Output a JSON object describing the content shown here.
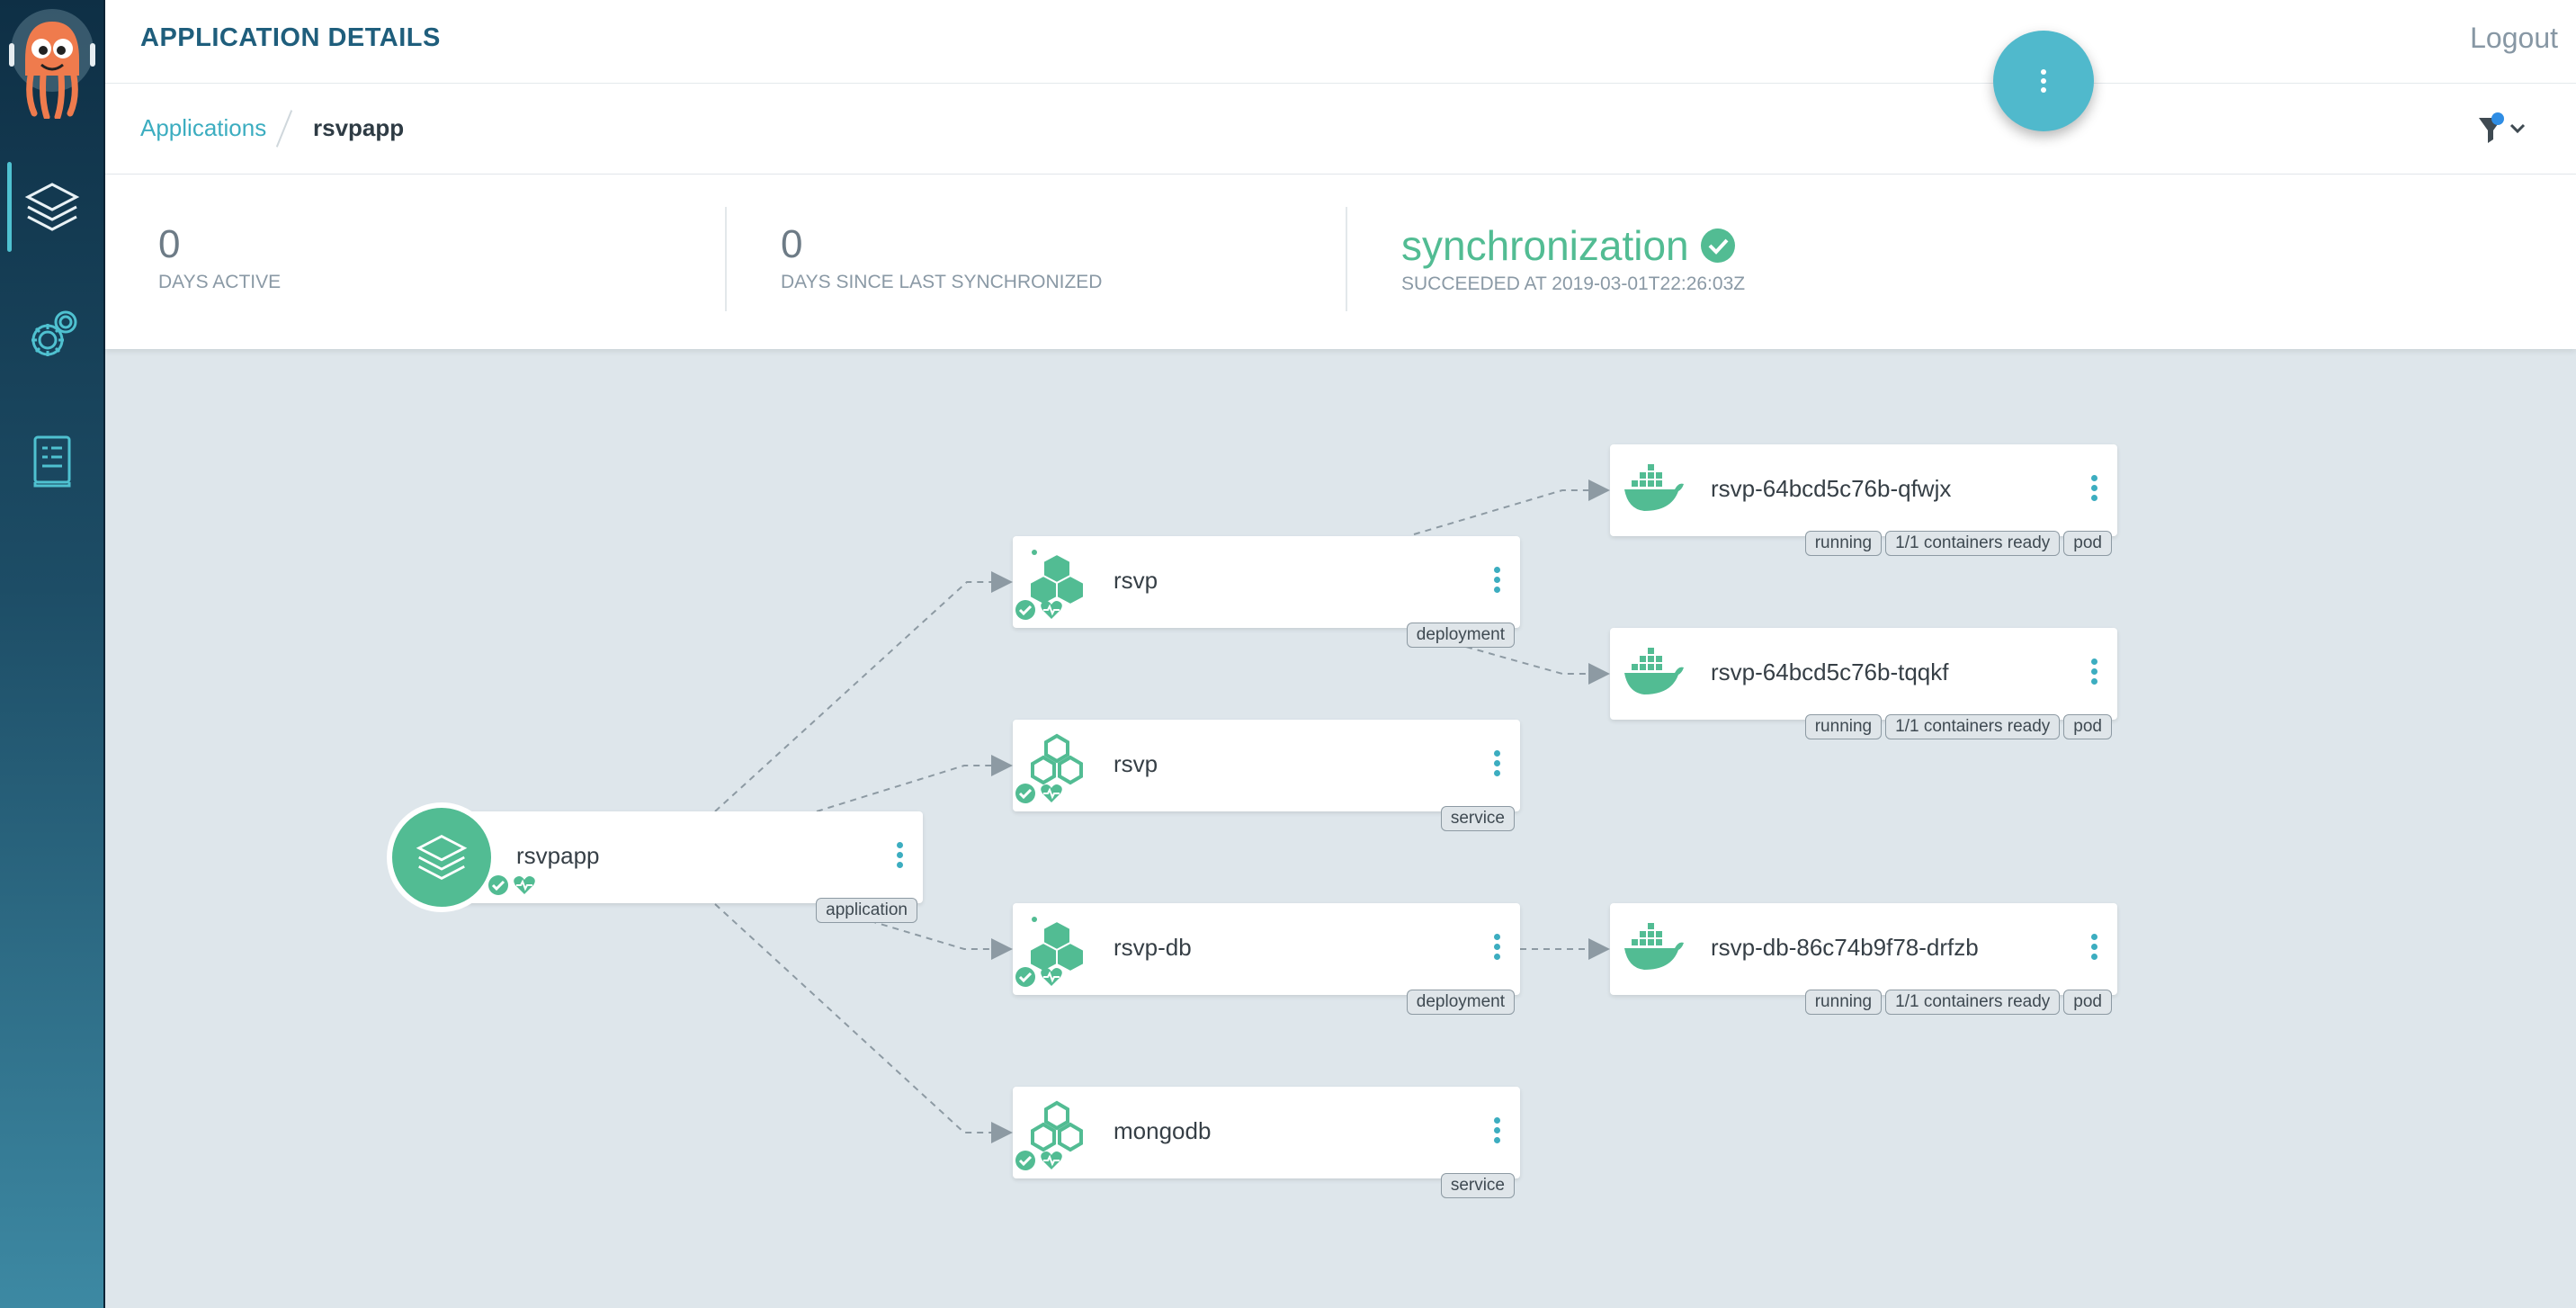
{
  "header": {
    "title": "APPLICATION DETAILS",
    "logout_label": "Logout"
  },
  "breadcrumb": {
    "root": "Applications",
    "current": "rsvpapp"
  },
  "stats": {
    "days_active": {
      "value": "0",
      "label": "DAYS ACTIVE"
    },
    "days_since_sync": {
      "value": "0",
      "label": "DAYS SINCE LAST SYNCHRONIZED"
    },
    "sync": {
      "title": "synchronization",
      "subtitle": "SUCCEEDED AT 2019-03-01T22:26:03Z"
    }
  },
  "colors": {
    "healthy": "#52bc93",
    "accent": "#3cadc0",
    "sidebar": "#0e2f45"
  },
  "sidebar": {
    "items": [
      {
        "name": "applications",
        "icon": "layers-icon"
      },
      {
        "name": "settings",
        "icon": "gear-icon"
      },
      {
        "name": "user-info",
        "icon": "docs-icon"
      }
    ]
  },
  "graph": {
    "application": {
      "name": "rsvpapp",
      "kind": "application"
    },
    "resources": [
      {
        "name": "rsvp",
        "kind": "deployment"
      },
      {
        "name": "rsvp",
        "kind": "service"
      },
      {
        "name": "rsvp-db",
        "kind": "deployment"
      },
      {
        "name": "mongodb",
        "kind": "service"
      }
    ],
    "pods": [
      {
        "name": "rsvp-64bcd5c76b-qfwjx",
        "tags": [
          "running",
          "1/1 containers ready",
          "pod"
        ]
      },
      {
        "name": "rsvp-64bcd5c76b-tqqkf",
        "tags": [
          "running",
          "1/1 containers ready",
          "pod"
        ]
      },
      {
        "name": "rsvp-db-86c74b9f78-drfzb",
        "tags": [
          "running",
          "1/1 containers ready",
          "pod"
        ]
      }
    ]
  }
}
